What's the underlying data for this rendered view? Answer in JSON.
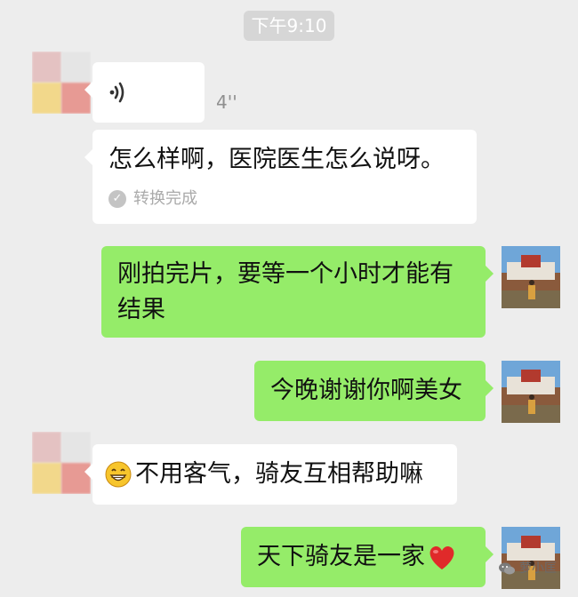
{
  "timestamp": "下午9:10",
  "colors": {
    "background": "#ededed",
    "incoming_bubble": "#ffffff",
    "outgoing_bubble": "#95ec69",
    "timestamp_bg": "#d6d6d6"
  },
  "messages": [
    {
      "side": "incoming",
      "type": "voice",
      "icon": "voice-wave-icon",
      "duration": "4''"
    },
    {
      "side": "incoming",
      "type": "voice-to-text",
      "text": "怎么样啊，医院医生怎么说呀。",
      "status": "转换完成",
      "status_icon": "check-circle-icon"
    },
    {
      "side": "outgoing",
      "type": "text",
      "text": "刚拍完片，要等一个小时才能有结果"
    },
    {
      "side": "outgoing",
      "type": "text",
      "text": "今晚谢谢你啊美女"
    },
    {
      "side": "incoming",
      "type": "text",
      "emoji": "grinning-face-icon",
      "text": "不用客气，骑友互相帮助嘛"
    },
    {
      "side": "outgoing",
      "type": "text",
      "text": "天下骑友是一家",
      "emoji": "red-heart-icon"
    }
  ],
  "watermark": {
    "icon": "wechat-icon",
    "text": "萝小匡"
  }
}
